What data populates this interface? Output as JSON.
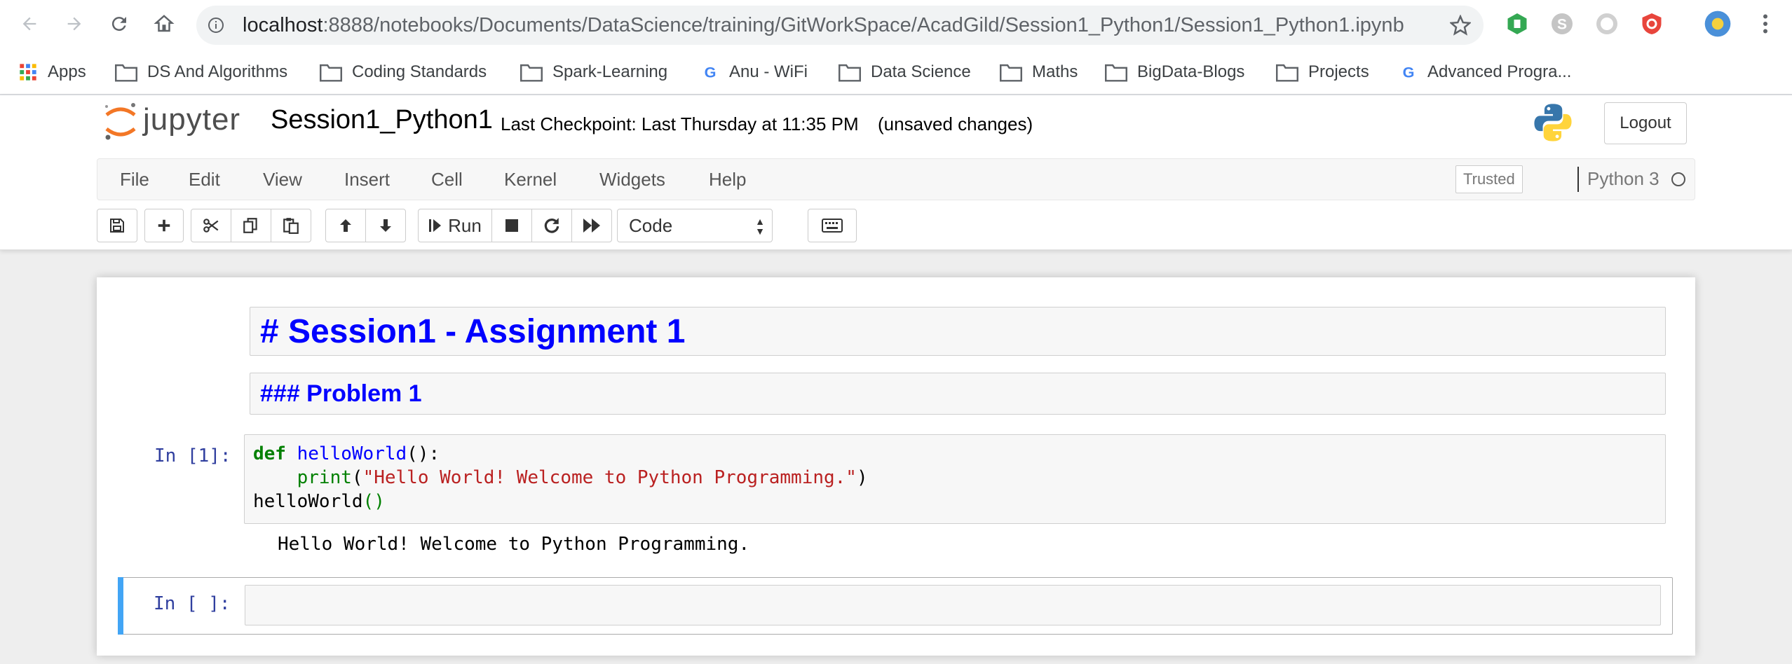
{
  "browser": {
    "url_host": "localhost",
    "url_rest": ":8888/notebooks/Documents/DataScience/training/GitWorkSpace/AcadGild/Session1_Python1/Session1_Python1.ipynb",
    "bookmarks": [
      {
        "label": "Apps",
        "icon": "apps-grid-icon"
      },
      {
        "label": "DS And Algorithms",
        "icon": "folder-icon"
      },
      {
        "label": "Coding Standards",
        "icon": "folder-icon"
      },
      {
        "label": "Spark-Learning",
        "icon": "folder-icon"
      },
      {
        "label": "Anu - WiFi",
        "icon": "google-g-icon"
      },
      {
        "label": "Data Science",
        "icon": "folder-icon"
      },
      {
        "label": "Maths",
        "icon": "folder-icon"
      },
      {
        "label": "BigData-Blogs",
        "icon": "folder-icon"
      },
      {
        "label": "Projects",
        "icon": "folder-icon"
      },
      {
        "label": "Advanced Progra...",
        "icon": "google-g-icon"
      }
    ]
  },
  "header": {
    "logo_text": "jupyter",
    "notebook_name": "Session1_Python1",
    "checkpoint": "Last Checkpoint: Last Thursday at 11:35 PM",
    "unsaved": "(unsaved changes)",
    "logout": "Logout"
  },
  "menu": {
    "items": [
      "File",
      "Edit",
      "View",
      "Insert",
      "Cell",
      "Kernel",
      "Widgets",
      "Help"
    ],
    "trusted": "Trusted",
    "kernel": "Python 3"
  },
  "toolbar": {
    "run_label": "Run",
    "cell_type": "Code"
  },
  "cells": {
    "md1": "# Session1 - Assignment 1",
    "md2": "### Problem 1",
    "code_prompt": "In [1]:",
    "code_line1_kw": "def",
    "code_line1_fn": "helloWorld",
    "code_line1_rest": "():",
    "code_line2_indent": "    ",
    "code_line2_fn": "print",
    "code_line2_open": "(",
    "code_line2_str": "\"Hello World! Welcome to Python Programming.\"",
    "code_line2_close": ")",
    "code_line3_fn": "helloWorld",
    "code_line3_paren": "()",
    "output": "Hello World! Welcome to Python Programming.",
    "empty_prompt": "In [ ]:"
  },
  "colors": {
    "accent_selected": "#42a5f5",
    "prompt": "#303f9f",
    "markdown_heading": "#0000ff"
  }
}
